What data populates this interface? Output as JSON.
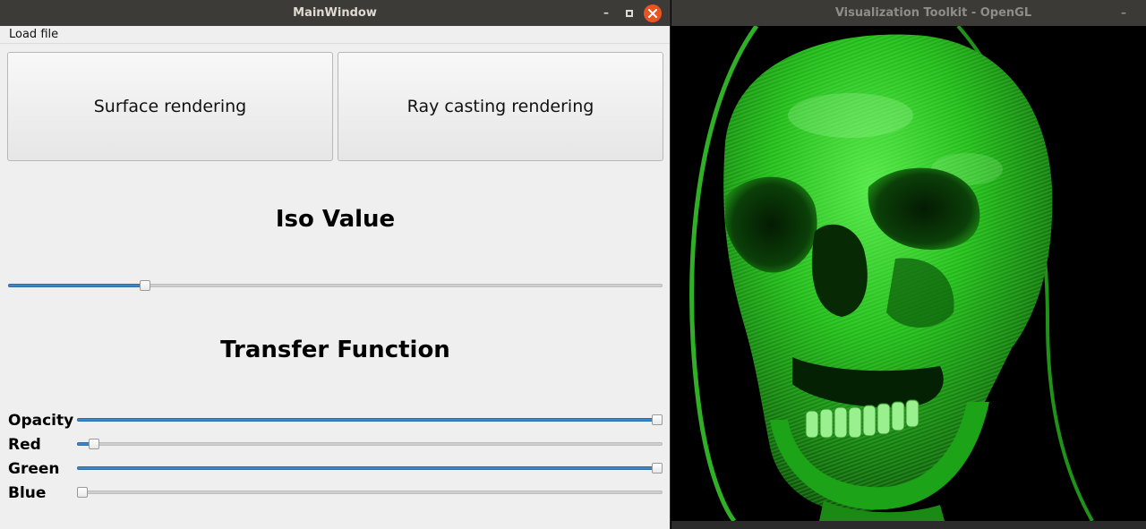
{
  "main_window": {
    "title": "MainWindow",
    "controls": {
      "minimize": "–",
      "close": "×"
    },
    "menu": {
      "load_file": "Load file"
    },
    "buttons": {
      "surface": "Surface rendering",
      "raycast": "Ray casting rendering"
    },
    "iso": {
      "heading": "Iso Value",
      "value_fraction": 0.205
    },
    "transfer": {
      "heading": "Transfer Function",
      "sliders": [
        {
          "label": "Opacity",
          "value_fraction": 1.0
        },
        {
          "label": "Red",
          "value_fraction": 0.02
        },
        {
          "label": "Green",
          "value_fraction": 1.0
        },
        {
          "label": "Blue",
          "value_fraction": 0.0
        }
      ]
    }
  },
  "vtk_window": {
    "title": "Visualization Toolkit - OpenGL",
    "minimize": "–",
    "render_color": "#22c41a"
  },
  "colors": {
    "accent": "#3d86c6",
    "close_button": "#e95420"
  }
}
